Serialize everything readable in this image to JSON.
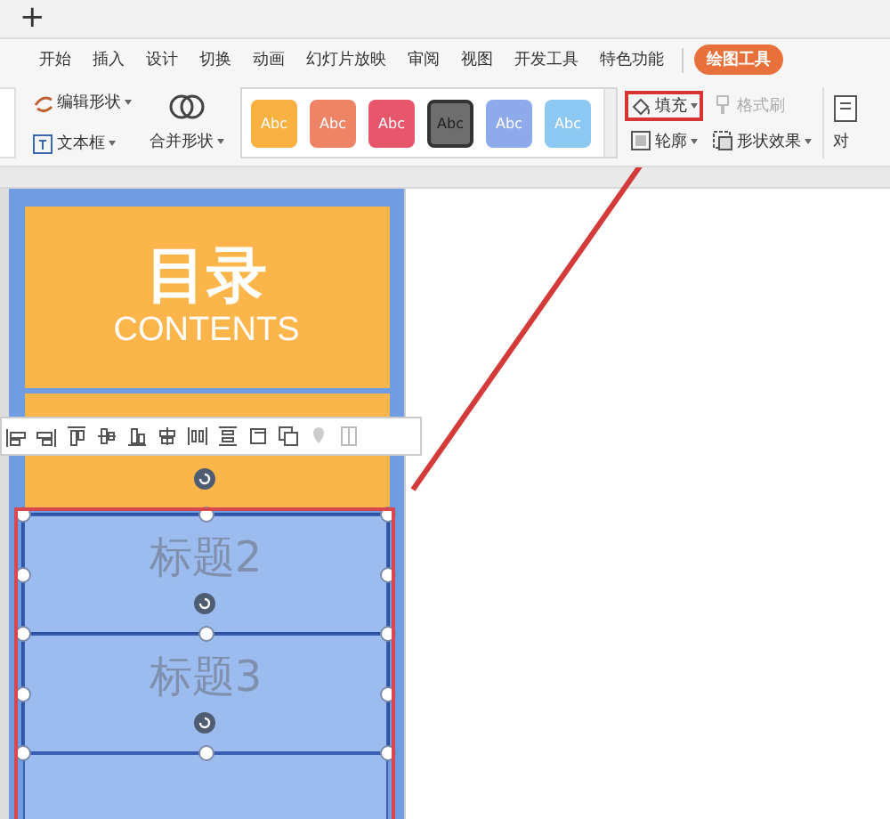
{
  "tab_strip": {
    "new_tab": "+"
  },
  "menu": [
    {
      "label": "开始",
      "selected": false
    },
    {
      "label": "插入",
      "selected": false
    },
    {
      "label": "设计",
      "selected": false
    },
    {
      "label": "切换",
      "selected": false
    },
    {
      "label": "动画",
      "selected": false
    },
    {
      "label": "幻灯片放映",
      "selected": false
    },
    {
      "label": "审阅",
      "selected": false
    },
    {
      "label": "视图",
      "selected": false
    },
    {
      "label": "开发工具",
      "selected": false
    },
    {
      "label": "特色功能",
      "selected": false
    },
    {
      "label": "绘图工具",
      "selected": true
    }
  ],
  "ribbon": {
    "shape_tools": [
      {
        "label": "编辑形状",
        "kind": "edit"
      },
      {
        "label": "文本框",
        "kind": "textbox"
      }
    ],
    "merge": {
      "label": "合并形状"
    },
    "styles": [
      {
        "label": "Abc",
        "color": "#f9b141",
        "selected": false
      },
      {
        "label": "Abc",
        "color": "#ee8366",
        "selected": false
      },
      {
        "label": "Abc",
        "color": "#e7566a",
        "selected": false
      },
      {
        "label": "Abc",
        "color": "#6e6e6e",
        "selected": true
      },
      {
        "label": "Abc",
        "color": "#8eaaea",
        "selected": false
      },
      {
        "label": "Abc",
        "color": "#8dc8f2",
        "selected": false
      }
    ],
    "format": [
      {
        "label": "填充",
        "kind": "fill",
        "disabled": false,
        "highlighted": true
      },
      {
        "label": "格式刷",
        "kind": "brush",
        "disabled": true,
        "highlighted": false
      },
      {
        "label": "轮廓",
        "kind": "outline",
        "disabled": false,
        "highlighted": false
      },
      {
        "label": "形状效果",
        "kind": "effect",
        "disabled": false,
        "highlighted": false
      }
    ],
    "cut_label": "对"
  },
  "slide": {
    "title": "目录",
    "subtitle": "CONTENTS",
    "items": [
      {
        "label": "标题2",
        "selected": true
      },
      {
        "label": "标题3",
        "selected": true
      }
    ]
  }
}
